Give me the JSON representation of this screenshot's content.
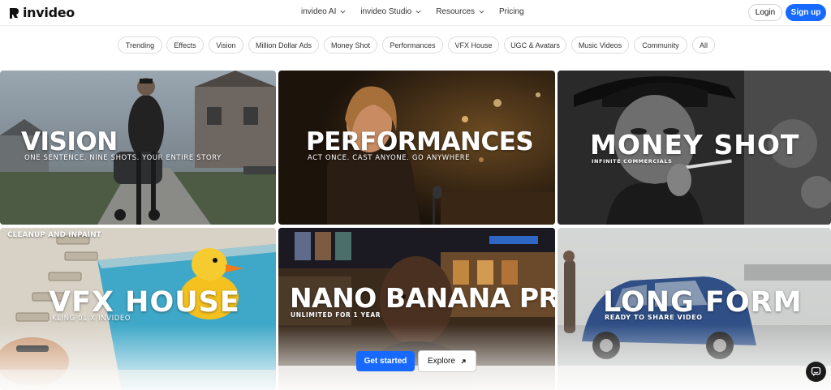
{
  "brand": {
    "name": "invideo"
  },
  "nav": {
    "items": [
      {
        "label": "invideo AI"
      },
      {
        "label": "invideo Studio"
      },
      {
        "label": "Resources"
      },
      {
        "label": "Pricing"
      }
    ],
    "login_label": "Login",
    "signup_label": "Sign up"
  },
  "categories": [
    "Trending",
    "Effects",
    "Vision",
    "Million Dollar Ads",
    "Money Shot",
    "Performances",
    "VFX House",
    "UGC & Avatars",
    "Music Videos",
    "Community",
    "All"
  ],
  "tiles": {
    "vision": {
      "title": "VISION",
      "subtitle": "ONE SENTENCE. NINE SHOTS. YOUR ENTIRE STORY"
    },
    "performances": {
      "title": "PERFORMANCES",
      "subtitle": "ACT ONCE. CAST ANYONE. GO ANYWHERE"
    },
    "money_shot": {
      "title": "MONEY SHOT",
      "subtitle": "INFINITE COMMERCIALS"
    },
    "vfx_house": {
      "tag": "CLEANUP AND INPAINT",
      "title": "VFX HOUSE",
      "subtitle": "KLING 01 X INVIDEO"
    },
    "nano_banana": {
      "title": "NANO BANANA PRO",
      "subtitle": "UNLIMITED FOR 1 YEAR"
    },
    "long_form": {
      "title": "LONG FORM",
      "subtitle": "READY TO SHARE VIDEO"
    }
  },
  "cta": {
    "primary_label": "Get started",
    "secondary_label": "Explore"
  },
  "colors": {
    "accent": "#1769ff",
    "text": "#1a1a1a",
    "chip_border": "#dcdcdc"
  },
  "icons": [
    "invideo-logo-icon",
    "chevron-down-icon",
    "arrow-up-right-icon",
    "chat-icon"
  ]
}
